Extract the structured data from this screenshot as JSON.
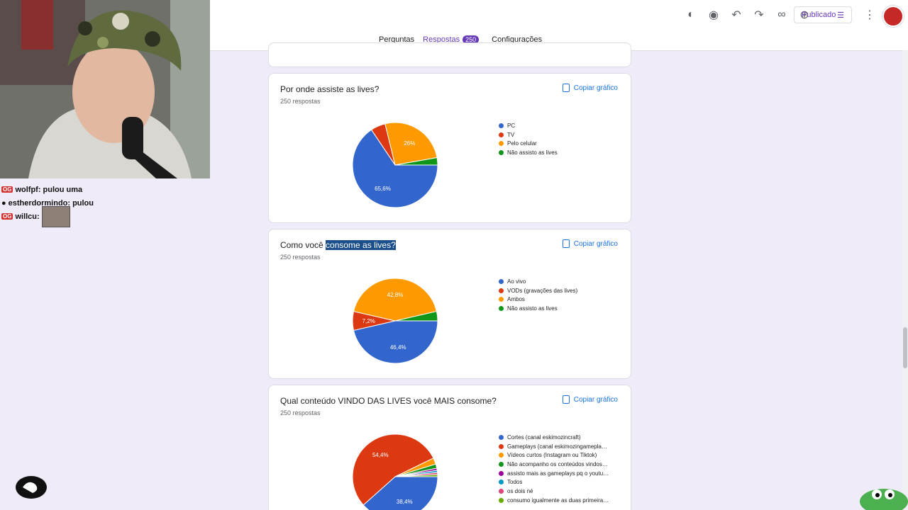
{
  "app": {
    "publish_label": "Publicado",
    "tabs": [
      {
        "label": "Perguntas",
        "active": false
      },
      {
        "label": "Respostas",
        "active": true,
        "badge": "250"
      },
      {
        "label": "Configurações",
        "active": false
      }
    ],
    "toolbar_icons": [
      "palette-icon",
      "preview-eye-icon",
      "undo-icon",
      "redo-icon",
      "link-icon",
      "add-collaborator-icon"
    ]
  },
  "copy_label": "Copiar gráfico",
  "cards": [
    {
      "title": "Por onde assiste as lives?",
      "count": "250 respostas",
      "legend": [
        "PC",
        "TV",
        "Pelo celular",
        "Não assisto as lives"
      ],
      "colors": [
        "#3366cc",
        "#dc3912",
        "#ff9900",
        "#109618"
      ],
      "labels": [
        "65,6%",
        "",
        "26%",
        ""
      ]
    },
    {
      "title_pre": "Como você ",
      "title_hl": "consome as lives?",
      "count": "250 respostas",
      "legend": [
        "Ao vivo",
        "VODs (gravações das lives)",
        "Ambos",
        "Não assisto as lives"
      ],
      "colors": [
        "#3366cc",
        "#dc3912",
        "#ff9900",
        "#109618"
      ],
      "labels": [
        "46,4%",
        "7,2%",
        "42,8%",
        ""
      ]
    },
    {
      "title": "Qual conteúdo VINDO DAS LIVES você MAIS consome?",
      "count": "250 respostas",
      "legend": [
        "Cortes (canal eskimozincraft)",
        "Gameplays (canal eskimozingamepla…",
        "Vídeos curtos (Instagram ou Tiktok)",
        "Não acompanho os conteúdos vindos…",
        "assisto mais as gameplays pq o youtu…",
        "Todos",
        "os dois né",
        "consumo igualmente as duas primeira…"
      ],
      "colors": [
        "#3366cc",
        "#dc3912",
        "#ff9900",
        "#109618",
        "#990099",
        "#0099c6",
        "#dd4477",
        "#66aa00"
      ],
      "labels": [
        "38,4%",
        "54,4%"
      ]
    }
  ],
  "chart_data": [
    {
      "type": "pie",
      "title": "Por onde assiste as lives?",
      "categories": [
        "PC",
        "TV",
        "Pelo celular",
        "Não assisto as lives"
      ],
      "values": [
        65.6,
        5.6,
        26,
        2.8
      ]
    },
    {
      "type": "pie",
      "title": "Como você consome as lives?",
      "categories": [
        "Ao vivo",
        "VODs (gravações das lives)",
        "Ambos",
        "Não assisto as lives"
      ],
      "values": [
        46.4,
        7.2,
        42.8,
        3.6
      ]
    },
    {
      "type": "pie",
      "title": "Qual conteúdo VINDO DAS LIVES você MAIS consome?",
      "categories": [
        "Cortes (canal eskimozincraft)",
        "Gameplays (canal eskimozingamepla…",
        "Vídeos curtos (Instagram ou Tiktok)",
        "Não acompanho os conteúdos vindos…",
        "assisto mais as gameplays pq o youtu…",
        "Todos",
        "os dois né",
        "consumo igualmente as duas primeira…"
      ],
      "values": [
        38.4,
        54.4,
        2.4,
        1.6,
        0.8,
        0.8,
        0.8,
        0.8
      ]
    }
  ],
  "stream": {
    "chat": [
      {
        "user": "wolfpf:",
        "message": "pulou uma",
        "badges": [
          "OG"
        ]
      },
      {
        "user": "estherdormindo:",
        "message": "pulou",
        "badges": []
      },
      {
        "user": "willcu:",
        "message": "",
        "badges": [
          "OG"
        ]
      }
    ]
  }
}
